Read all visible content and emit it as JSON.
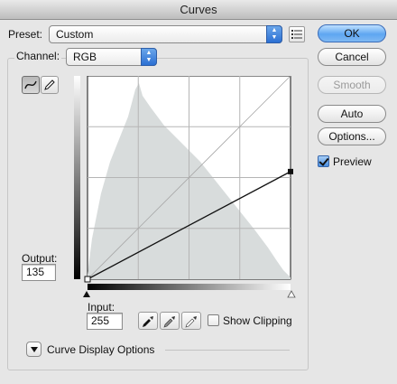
{
  "window": {
    "title": "Curves"
  },
  "preset": {
    "label": "Preset:",
    "value": "Custom",
    "menu_icon": "list-options-icon"
  },
  "channel": {
    "label": "Channel:",
    "value": "RGB"
  },
  "buttons": {
    "ok": "OK",
    "cancel": "Cancel",
    "smooth": "Smooth",
    "auto": "Auto",
    "options": "Options..."
  },
  "preview": {
    "label": "Preview",
    "checked": true
  },
  "tools": {
    "curve": "curve-point-icon",
    "pencil": "pencil-icon"
  },
  "output": {
    "label": "Output:",
    "value": "135"
  },
  "input": {
    "label": "Input:",
    "value": "255"
  },
  "eyedroppers": [
    "black-eyedropper-icon",
    "gray-eyedropper-icon",
    "white-eyedropper-icon"
  ],
  "show_clipping": {
    "label": "Show Clipping",
    "checked": false
  },
  "display_options": {
    "label": "Curve Display Options"
  },
  "colors": {
    "accent": "#3b7fde",
    "histogram": "#d6d6d6",
    "grid_bg": "#ffffff"
  },
  "curve": {
    "input_range": [
      0,
      255
    ],
    "output_range": [
      0,
      255
    ],
    "points": [
      [
        0,
        0
      ],
      [
        255,
        135
      ]
    ]
  }
}
